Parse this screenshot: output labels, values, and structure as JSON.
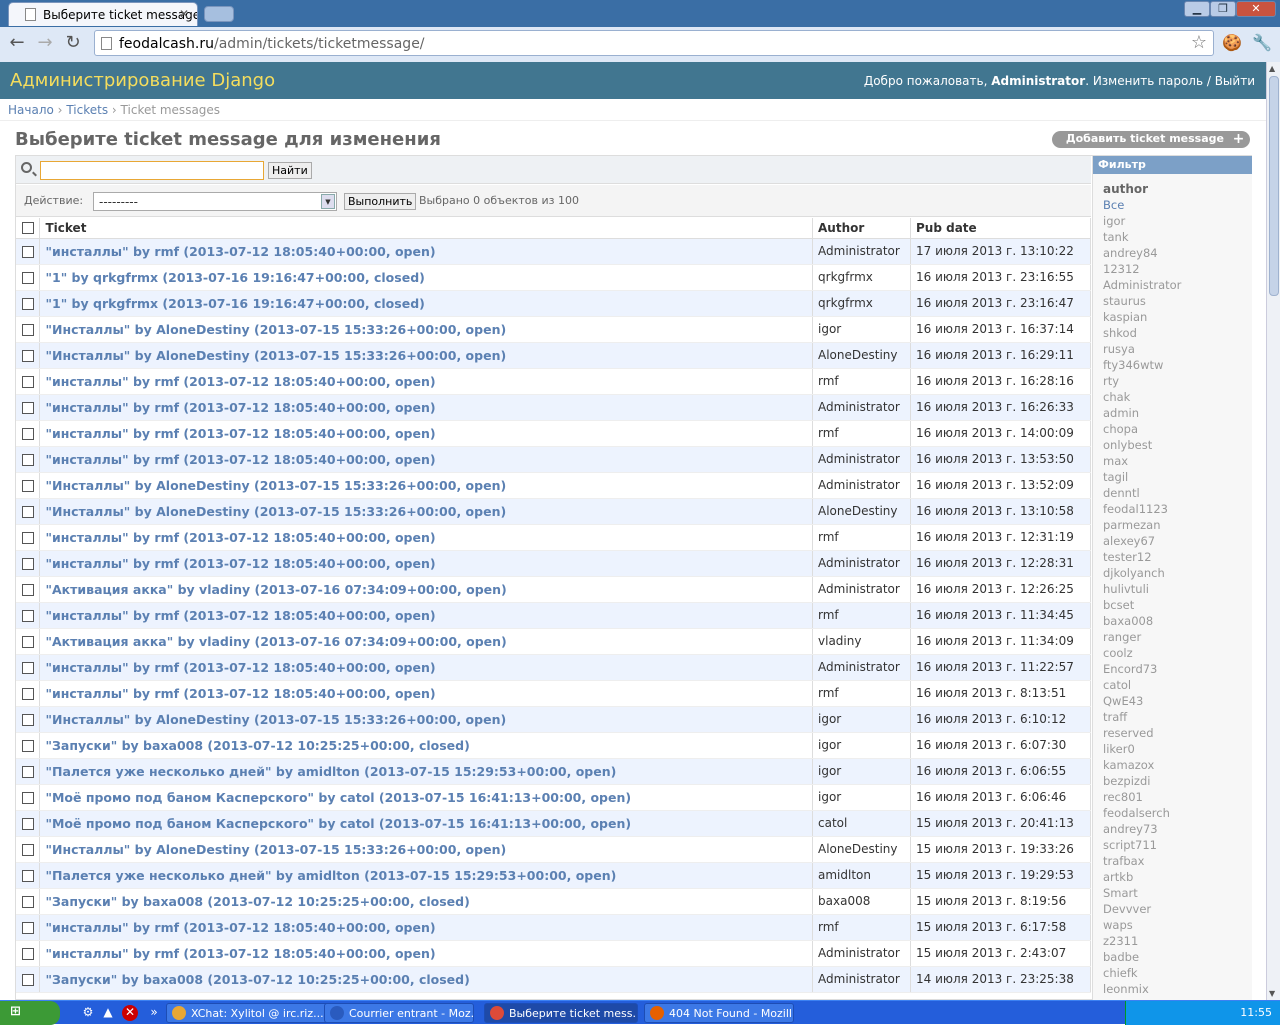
{
  "browser": {
    "tab_title": "Выберите ticket message дл",
    "url_host": "feodalcash.ru",
    "url_path": "/admin/tickets/ticketmessage/"
  },
  "header": {
    "brand": "Администрирование Django",
    "welcome": "Добро пожаловать,",
    "user": "Administrator",
    "tools_tail": ". Изменить пароль / Выйти"
  },
  "breadcrumbs": {
    "home": "Начало",
    "app": "Tickets",
    "current": "Ticket messages",
    "sep": "›"
  },
  "title": "Выберите ticket message для изменения",
  "add_button": "Добавить ticket message",
  "search": {
    "button": "Найти"
  },
  "actions": {
    "label": "Действие:",
    "select_value": "---------",
    "go": "Выполнить",
    "counter": "Выбрано 0 объектов из 100"
  },
  "columns": [
    "Ticket",
    "Author",
    "Pub date"
  ],
  "rows": [
    [
      "\"инсталлы\" by rmf (2013-07-12 18:05:40+00:00, open)",
      "Administrator",
      "17 июля 2013 г. 13:10:22"
    ],
    [
      "\"1\" by qrkgfrmx (2013-07-16 19:16:47+00:00, closed)",
      "qrkgfrmx",
      "16 июля 2013 г. 23:16:55"
    ],
    [
      "\"1\" by qrkgfrmx (2013-07-16 19:16:47+00:00, closed)",
      "qrkgfrmx",
      "16 июля 2013 г. 23:16:47"
    ],
    [
      "\"Инсталлы\" by AloneDestiny (2013-07-15 15:33:26+00:00, open)",
      "igor",
      "16 июля 2013 г. 16:37:14"
    ],
    [
      "\"Инсталлы\" by AloneDestiny (2013-07-15 15:33:26+00:00, open)",
      "AloneDestiny",
      "16 июля 2013 г. 16:29:11"
    ],
    [
      "\"инсталлы\" by rmf (2013-07-12 18:05:40+00:00, open)",
      "rmf",
      "16 июля 2013 г. 16:28:16"
    ],
    [
      "\"инсталлы\" by rmf (2013-07-12 18:05:40+00:00, open)",
      "Administrator",
      "16 июля 2013 г. 16:26:33"
    ],
    [
      "\"инсталлы\" by rmf (2013-07-12 18:05:40+00:00, open)",
      "rmf",
      "16 июля 2013 г. 14:00:09"
    ],
    [
      "\"инсталлы\" by rmf (2013-07-12 18:05:40+00:00, open)",
      "Administrator",
      "16 июля 2013 г. 13:53:50"
    ],
    [
      "\"Инсталлы\" by AloneDestiny (2013-07-15 15:33:26+00:00, open)",
      "Administrator",
      "16 июля 2013 г. 13:52:09"
    ],
    [
      "\"Инсталлы\" by AloneDestiny (2013-07-15 15:33:26+00:00, open)",
      "AloneDestiny",
      "16 июля 2013 г. 13:10:58"
    ],
    [
      "\"инсталлы\" by rmf (2013-07-12 18:05:40+00:00, open)",
      "rmf",
      "16 июля 2013 г. 12:31:19"
    ],
    [
      "\"инсталлы\" by rmf (2013-07-12 18:05:40+00:00, open)",
      "Administrator",
      "16 июля 2013 г. 12:28:31"
    ],
    [
      "\"Активация акка\" by vladiny (2013-07-16 07:34:09+00:00, open)",
      "Administrator",
      "16 июля 2013 г. 12:26:25"
    ],
    [
      "\"инсталлы\" by rmf (2013-07-12 18:05:40+00:00, open)",
      "rmf",
      "16 июля 2013 г. 11:34:45"
    ],
    [
      "\"Активация акка\" by vladiny (2013-07-16 07:34:09+00:00, open)",
      "vladiny",
      "16 июля 2013 г. 11:34:09"
    ],
    [
      "\"инсталлы\" by rmf (2013-07-12 18:05:40+00:00, open)",
      "Administrator",
      "16 июля 2013 г. 11:22:57"
    ],
    [
      "\"инсталлы\" by rmf (2013-07-12 18:05:40+00:00, open)",
      "rmf",
      "16 июля 2013 г. 8:13:51"
    ],
    [
      "\"Инсталлы\" by AloneDestiny (2013-07-15 15:33:26+00:00, open)",
      "igor",
      "16 июля 2013 г. 6:10:12"
    ],
    [
      "\"Запуски\" by baxa008 (2013-07-12 10:25:25+00:00, closed)",
      "igor",
      "16 июля 2013 г. 6:07:30"
    ],
    [
      "\"Палется уже несколько дней\" by amidlton (2013-07-15 15:29:53+00:00, open)",
      "igor",
      "16 июля 2013 г. 6:06:55"
    ],
    [
      "\"Моё промо под баном Касперского\" by catol (2013-07-15 16:41:13+00:00, open)",
      "igor",
      "16 июля 2013 г. 6:06:46"
    ],
    [
      "\"Моё промо под баном Касперского\" by catol (2013-07-15 16:41:13+00:00, open)",
      "catol",
      "15 июля 2013 г. 20:41:13"
    ],
    [
      "\"Инсталлы\" by AloneDestiny (2013-07-15 15:33:26+00:00, open)",
      "AloneDestiny",
      "15 июля 2013 г. 19:33:26"
    ],
    [
      "\"Палется уже несколько дней\" by amidlton (2013-07-15 15:29:53+00:00, open)",
      "amidlton",
      "15 июля 2013 г. 19:29:53"
    ],
    [
      "\"Запуски\" by baxa008 (2013-07-12 10:25:25+00:00, closed)",
      "baxa008",
      "15 июля 2013 г. 8:19:56"
    ],
    [
      "\"инсталлы\" by rmf (2013-07-12 18:05:40+00:00, open)",
      "rmf",
      "15 июля 2013 г. 6:17:58"
    ],
    [
      "\"инсталлы\" by rmf (2013-07-12 18:05:40+00:00, open)",
      "Administrator",
      "15 июля 2013 г. 2:43:07"
    ],
    [
      "\"Запуски\" by baxa008 (2013-07-12 10:25:25+00:00, closed)",
      "Administrator",
      "14 июля 2013 г. 23:25:38"
    ]
  ],
  "filter": {
    "title": "Фильтр",
    "by": "author",
    "items": [
      "Все",
      "igor",
      "tank",
      "andrey84",
      "12312",
      "Administrator",
      "staurus",
      "kaspian",
      "shkod",
      "rusya",
      "fty346wtw",
      "rty",
      "chak",
      "admin",
      "chopa",
      "onlybest",
      "max",
      "tagil",
      "denntl",
      "feodal1123",
      "parmezan",
      "alexey67",
      "tester12",
      "djkolyanch",
      "hulivtuli",
      "bcset",
      "baxa008",
      "ranger",
      "coolz",
      "Encord73",
      "catol",
      "QwE43",
      "traff",
      "reserved",
      "liker0",
      "kamazox",
      "bezpizdi",
      "rec801",
      "feodalserch",
      "andrey73",
      "script711",
      "trafbax",
      "artkb",
      "Smart",
      "Devvver",
      "waps",
      "z2311",
      "badbe",
      "chiefk",
      "leonmix"
    ]
  },
  "taskbar": {
    "start": "",
    "items": [
      "XChat: Xylitol @ irc.riz...",
      "Courrier entrant - Moz...",
      "Выберите ticket mess...",
      "404 Not Found - Mozill..."
    ],
    "clock": "11:55"
  }
}
